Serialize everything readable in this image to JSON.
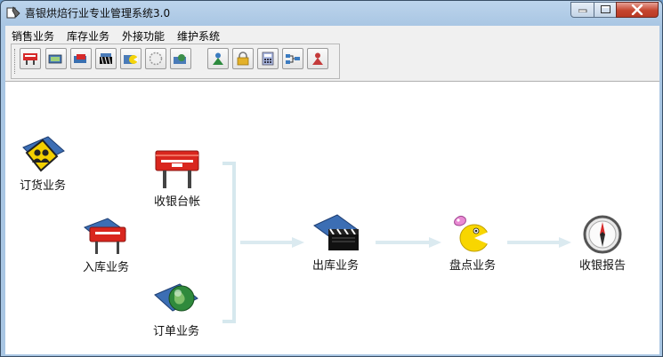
{
  "window": {
    "title": "喜银烘焙行业专业管理系统3.0"
  },
  "menu": [
    "销售业务",
    "库存业务",
    "外接功能",
    "维护系统"
  ],
  "toolbar": {
    "buttons": [
      {
        "name": "receipt-icon"
      },
      {
        "name": "computer-icon"
      },
      {
        "name": "cashbox-icon"
      },
      {
        "name": "clapper-icon"
      },
      {
        "name": "folder-pacman-icon"
      },
      {
        "name": "compass-icon"
      },
      {
        "name": "globe-folder-icon"
      },
      {
        "name": "user-icon"
      },
      {
        "name": "lock-icon"
      },
      {
        "name": "calculator-icon"
      },
      {
        "name": "network-icon"
      },
      {
        "name": "user-red-icon"
      }
    ]
  },
  "nodes": {
    "ordering": "订货业务",
    "cashier": "收银台帐",
    "stock_in": "入库业务",
    "order": "订单业务",
    "stock_out": "出库业务",
    "inventory": "盘点业务",
    "report": "收银报告"
  },
  "colors": {
    "arrow": "#dbeaf0",
    "bracket": "#d6e8ee",
    "title_bg": "#a9c6e3",
    "close": "#c5452f"
  }
}
